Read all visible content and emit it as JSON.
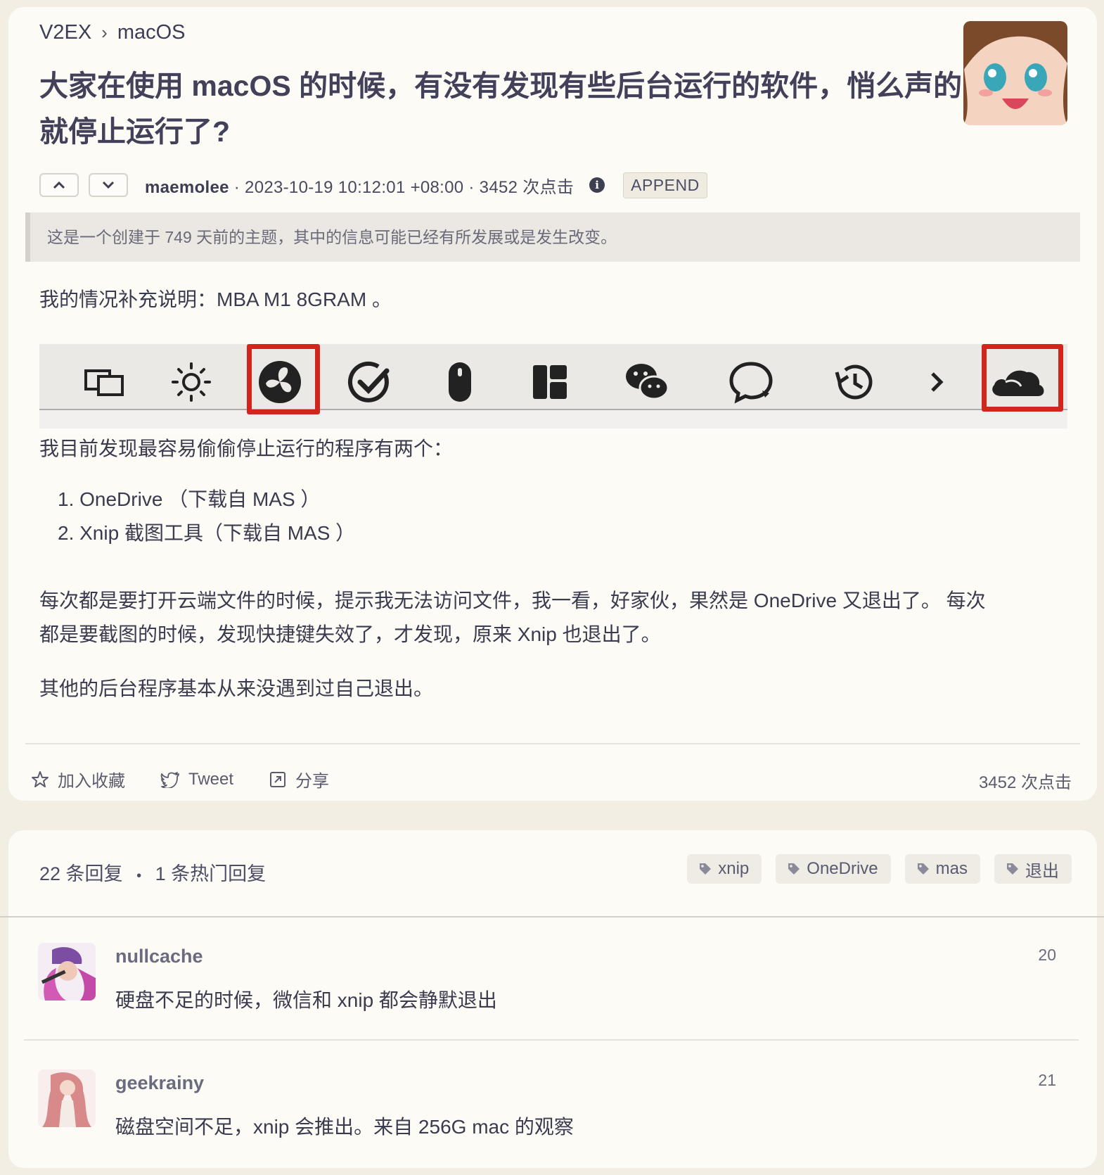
{
  "breadcrumb": {
    "site": "V2EX",
    "separator": "›",
    "node": "macOS"
  },
  "topic": {
    "title": "大家在使用 macOS 的时候，有没有发现有些后台运行的软件，悄么声的就停止运行了?",
    "author": "maemolee",
    "meta_rest": " · 2023-10-19 10:12:01 +08:00 · 3452 次点击",
    "append_label": "APPEND",
    "info_glyph": "i",
    "notice": "这是一个创建于 749 天前的主题，其中的信息可能已经有所发展或是发生改变。",
    "body": {
      "p1": "我的情况补充说明：MBA M1 8GRAM 。",
      "p2": "我目前发现最容易偷偷停止运行的程序有两个：",
      "list": [
        "1. OneDrive （下载自 MAS ）",
        "2. Xnip 截图工具（下载自 MAS ）"
      ],
      "p3a": "每次都是要打开云端文件的时候，提示我无法访问文件，我一看，好家伙，果然是 OneDrive 又退出了。 每次",
      "p3b": "都是要截图的时候，发现快捷键失效了，才发现，原来 Xnip 也退出了。",
      "p4": "其他的后台程序基本从来没遇到过自己退出。"
    },
    "menubar_icons": [
      "screens-icon",
      "brightness-icon",
      "fan-icon",
      "checkmark-icon",
      "mouse-icon",
      "layout-icon",
      "wechat-icon",
      "chat-bubble-icon",
      "time-machine-icon",
      "chevron-right-icon",
      "onedrive-cloud-icon"
    ],
    "actions": {
      "favorite": "加入收藏",
      "tweet": "Tweet",
      "share": "分享",
      "clicks": "3452 次点击"
    }
  },
  "replies_header": {
    "count": "22 条回复",
    "dot": "•",
    "hot": "1 条热门回复"
  },
  "tags": [
    "xnip",
    "OneDrive",
    "mas",
    "退出"
  ],
  "replies": [
    {
      "user": "nullcache",
      "text": "硬盘不足的时候，微信和 xnip 都会静默退出",
      "num": "20"
    },
    {
      "user": "geekrainy",
      "text": "磁盘空间不足，xnip 会推出。来自 256G mac 的观察",
      "num": "21"
    }
  ],
  "colors": {
    "accent_red": "#d0261b",
    "background": "#f3eee3",
    "card": "#fcfbf6"
  }
}
